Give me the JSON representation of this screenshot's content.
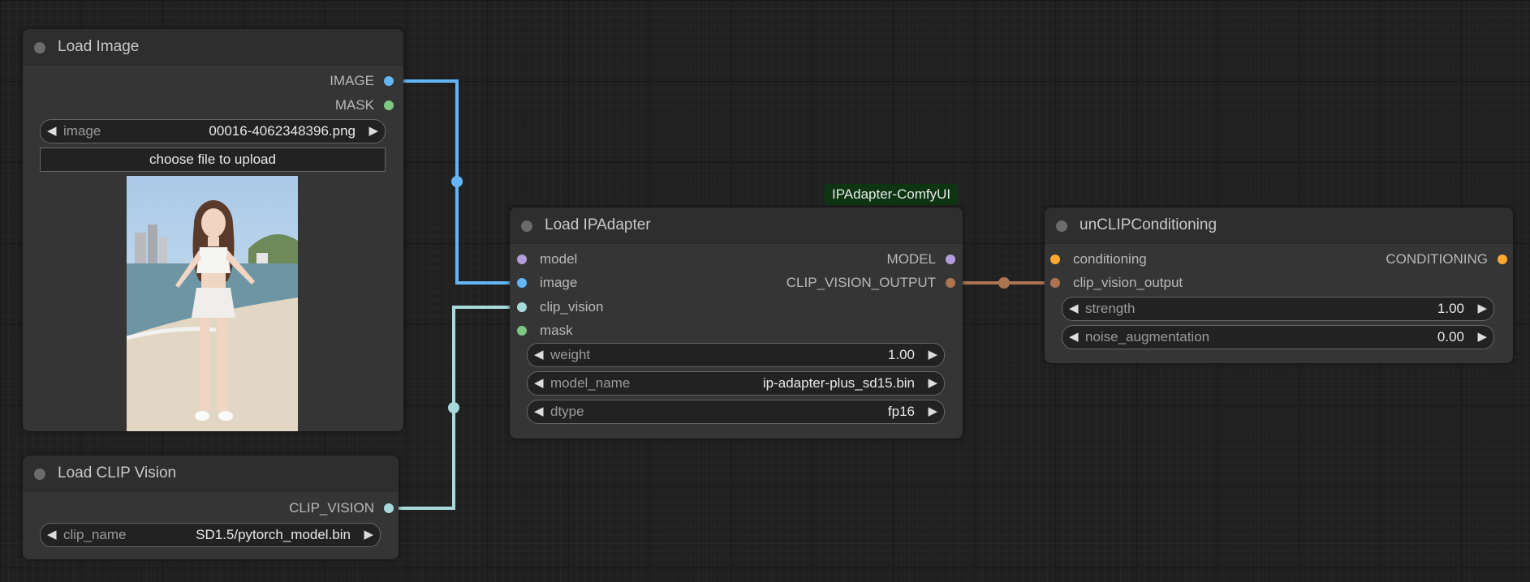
{
  "colors": {
    "image": "#64b5f6",
    "mask": "#81c784",
    "clip_vision": "#a8dadc",
    "model": "#b39ddb",
    "clip_vision_output": "#ad7452",
    "conditioning": "#ffa931"
  },
  "nodes": {
    "load_image": {
      "title": "Load Image",
      "outputs": {
        "image": "IMAGE",
        "mask": "MASK"
      },
      "image_widget": {
        "label": "image",
        "value": "00016-4062348396.png"
      },
      "upload_label": "choose file to upload"
    },
    "load_clip_vision": {
      "title": "Load CLIP Vision",
      "outputs": {
        "clip_vision": "CLIP_VISION"
      },
      "clip_name_widget": {
        "label": "clip_name",
        "value": "SD1.5/pytorch_model.bin"
      }
    },
    "load_ipadapter": {
      "title": "Load IPAdapter",
      "badge": "IPAdapter-ComfyUI",
      "inputs": {
        "model": "model",
        "image": "image",
        "clip_vision": "clip_vision",
        "mask": "mask"
      },
      "outputs": {
        "model": "MODEL",
        "clip_vision_output": "CLIP_VISION_OUTPUT"
      },
      "weight_widget": {
        "label": "weight",
        "value": "1.00"
      },
      "model_name_widget": {
        "label": "model_name",
        "value": "ip-adapter-plus_sd15.bin"
      },
      "dtype_widget": {
        "label": "dtype",
        "value": "fp16"
      }
    },
    "unclip_conditioning": {
      "title": "unCLIPConditioning",
      "inputs": {
        "conditioning": "conditioning",
        "clip_vision_output": "clip_vision_output"
      },
      "outputs": {
        "conditioning": "CONDITIONING"
      },
      "strength_widget": {
        "label": "strength",
        "value": "1.00"
      },
      "noise_widget": {
        "label": "noise_augmentation",
        "value": "0.00"
      }
    }
  },
  "arrows": {
    "left": "◀",
    "right": "▶"
  }
}
